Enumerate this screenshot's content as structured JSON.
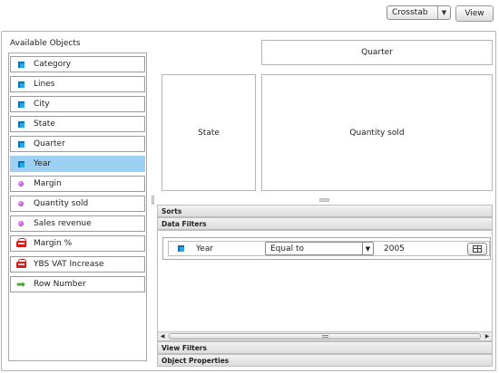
{
  "toolbar": {
    "view_type": "Crosstab",
    "view_button": "View"
  },
  "objects_panel": {
    "title": "Available Objects",
    "items": [
      {
        "label": "Category",
        "icon": "dimension-icon",
        "selected": false
      },
      {
        "label": "Lines",
        "icon": "dimension-icon",
        "selected": false
      },
      {
        "label": "City",
        "icon": "dimension-icon",
        "selected": false
      },
      {
        "label": "State",
        "icon": "dimension-icon",
        "selected": false
      },
      {
        "label": "Quarter",
        "icon": "dimension-icon",
        "selected": false
      },
      {
        "label": "Year",
        "icon": "dimension-icon",
        "selected": true
      },
      {
        "label": "Margin",
        "icon": "measure-icon",
        "selected": false
      },
      {
        "label": "Quantity sold",
        "icon": "measure-icon",
        "selected": false
      },
      {
        "label": "Sales revenue",
        "icon": "measure-icon",
        "selected": false
      },
      {
        "label": "Margin %",
        "icon": "calculation-icon",
        "selected": false
      },
      {
        "label": "YBS VAT Increase",
        "icon": "calculation-icon",
        "selected": false
      },
      {
        "label": "Row Number",
        "icon": "green-arrow-icon",
        "selected": false
      }
    ]
  },
  "layout": {
    "column_zone": "Quarter",
    "row_zone": "State",
    "body_zone": "Quantity sold"
  },
  "sections": {
    "sorts": "Sorts",
    "data_filters": "Data Filters",
    "view_filters": "View Filters",
    "object_properties": "Object Properties"
  },
  "filter": {
    "object": "Year",
    "operator": "Equal to",
    "value": "2005"
  },
  "colors": {
    "selected_row": "#9ed0f3",
    "dimension": "#28a8e6",
    "measure": "#a01cbd",
    "calculation": "#d01d1d",
    "arrow": "#3fa52b"
  }
}
